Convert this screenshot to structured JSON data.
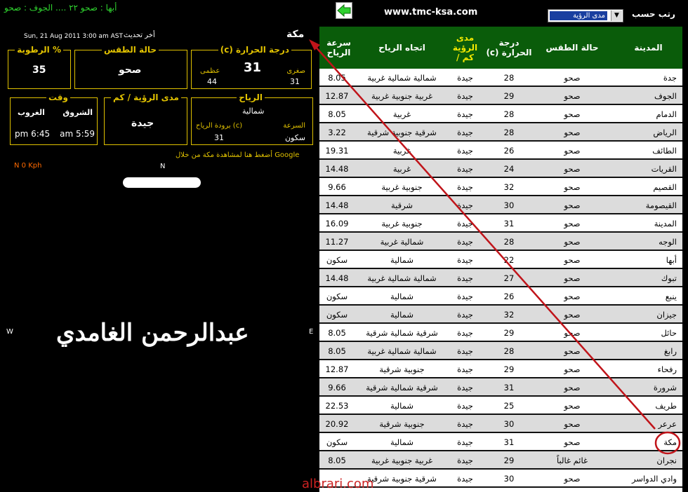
{
  "top": {
    "ticker": "أبها : صحو ٢٢  ....  الجوف : صحو",
    "site": "www.tmc-ksa.com",
    "sort_label": "رتب حسب",
    "sort_value": "مدى الرؤية",
    "sort_arrow": "▼"
  },
  "table": {
    "headers": {
      "city": "المدينة",
      "condition": "حالة الطقس",
      "temp": "درجة الحرارة (c)",
      "visibility": "مدى الرؤية كم /",
      "wind_dir": "اتجاه الرياح",
      "wind_speed": "سرعة الرياح"
    },
    "rows": [
      {
        "city": "جدة",
        "condition": "صحو",
        "temp": "28",
        "visibility": "جيدة",
        "wind_dir": "شمالية شمالية غربية",
        "wind_speed": "8.05"
      },
      {
        "city": "الجوف",
        "condition": "صحو",
        "temp": "29",
        "visibility": "جيدة",
        "wind_dir": "غربية جنوبية غربية",
        "wind_speed": "12.87"
      },
      {
        "city": "الدمام",
        "condition": "صحو",
        "temp": "28",
        "visibility": "جيدة",
        "wind_dir": "غربية",
        "wind_speed": "8.05"
      },
      {
        "city": "الرياض",
        "condition": "صحو",
        "temp": "28",
        "visibility": "جيدة",
        "wind_dir": "شرقية جنوبية شرقية",
        "wind_speed": "3.22"
      },
      {
        "city": "الطائف",
        "condition": "صحو",
        "temp": "26",
        "visibility": "جيدة",
        "wind_dir": "غربية",
        "wind_speed": "19.31"
      },
      {
        "city": "القريات",
        "condition": "صحو",
        "temp": "24",
        "visibility": "جيدة",
        "wind_dir": "غربية",
        "wind_speed": "14.48"
      },
      {
        "city": "القصيم",
        "condition": "صحو",
        "temp": "32",
        "visibility": "جيدة",
        "wind_dir": "جنوبية غربية",
        "wind_speed": "9.66"
      },
      {
        "city": "القيصومة",
        "condition": "صحو",
        "temp": "30",
        "visibility": "جيدة",
        "wind_dir": "شرقية",
        "wind_speed": "14.48"
      },
      {
        "city": "المدينة",
        "condition": "صحو",
        "temp": "31",
        "visibility": "جيدة",
        "wind_dir": "جنوبية غربية",
        "wind_speed": "16.09"
      },
      {
        "city": "الوجه",
        "condition": "صحو",
        "temp": "28",
        "visibility": "جيدة",
        "wind_dir": "شمالية غربية",
        "wind_speed": "11.27"
      },
      {
        "city": "أبها",
        "condition": "صحو",
        "temp": "22",
        "visibility": "جيدة",
        "wind_dir": "شمالية",
        "wind_speed": "سكون"
      },
      {
        "city": "تبوك",
        "condition": "صحو",
        "temp": "27",
        "visibility": "جيدة",
        "wind_dir": "شمالية شمالية غربية",
        "wind_speed": "14.48"
      },
      {
        "city": "ينبع",
        "condition": "صحو",
        "temp": "26",
        "visibility": "جيدة",
        "wind_dir": "شمالية",
        "wind_speed": "سكون"
      },
      {
        "city": "جيزان",
        "condition": "صحو",
        "temp": "32",
        "visibility": "جيدة",
        "wind_dir": "شمالية",
        "wind_speed": "سكون"
      },
      {
        "city": "حائل",
        "condition": "صحو",
        "temp": "29",
        "visibility": "جيدة",
        "wind_dir": "شرقية شمالية شرقية",
        "wind_speed": "8.05"
      },
      {
        "city": "رابغ",
        "condition": "صحو",
        "temp": "28",
        "visibility": "جيدة",
        "wind_dir": "شمالية شمالية غربية",
        "wind_speed": "8.05"
      },
      {
        "city": "رفحاء",
        "condition": "صحو",
        "temp": "29",
        "visibility": "جيدة",
        "wind_dir": "جنوبية شرقية",
        "wind_speed": "12.87"
      },
      {
        "city": "شرورة",
        "condition": "صحو",
        "temp": "31",
        "visibility": "جيدة",
        "wind_dir": "شرقية شمالية شرقية",
        "wind_speed": "9.66"
      },
      {
        "city": "طريف",
        "condition": "صحو",
        "temp": "25",
        "visibility": "جيدة",
        "wind_dir": "شمالية",
        "wind_speed": "22.53"
      },
      {
        "city": "عرعر",
        "condition": "صحو",
        "temp": "30",
        "visibility": "جيدة",
        "wind_dir": "جنوبية شرقية",
        "wind_speed": "20.92"
      },
      {
        "city": "مكة",
        "condition": "صحو",
        "temp": "31",
        "visibility": "جيدة",
        "wind_dir": "شمالية",
        "wind_speed": "سكون"
      },
      {
        "city": "نجران",
        "condition": "غائم غالباً",
        "temp": "29",
        "visibility": "جيدة",
        "wind_dir": "غربية جنوبية غربية",
        "wind_speed": "8.05"
      },
      {
        "city": "وادي الدواسر",
        "condition": "صحو",
        "temp": "30",
        "visibility": "جيدة",
        "wind_dir": "شرقية جنوبية شرقية",
        "wind_speed": ""
      }
    ]
  },
  "detail": {
    "city": "مكة",
    "last_update_label": "أخر تحديث",
    "last_update": "Sun, 21 Aug 2011 3:00 am AST",
    "temp_title": "درجة الحرارة (c)",
    "temp_current": "31",
    "temp_min_label": "صغرى",
    "temp_min": "31",
    "temp_max_label": "عظمى",
    "temp_max": "44",
    "condition_title": "حالة الطقس",
    "condition": "صحو",
    "humidity_title": "% الرطوبة",
    "humidity": "35",
    "wind_title": "الرياح",
    "wind_dir": "شمالية",
    "wind_speed_label": "السرعة",
    "wind_speed": "سكون",
    "wind_chill_label": "(c) برودة الرياح",
    "wind_chill": "31",
    "visibility_title": "مدى الرؤية / كم",
    "visibility": "جيدة",
    "time_title": "وقت",
    "sunrise_label": "الشروق",
    "sunrise": "5:59 am",
    "sunset_label": "الغروب",
    "sunset": "6:45 pm",
    "google_link": "Google أضغط هنا لمشاهدة مكة من خلال",
    "wind_readout": "N  0 Kph",
    "compass_n": "N",
    "compass_w": "W",
    "compass_e": "E",
    "author": "عبدالرحمن الغامدي"
  },
  "watermark": "albrari.com",
  "colors": {
    "header_green": "#0a5c0a",
    "gold": "#e0c100",
    "annotation": "#c0141a",
    "ticker": "#2fd12f"
  }
}
